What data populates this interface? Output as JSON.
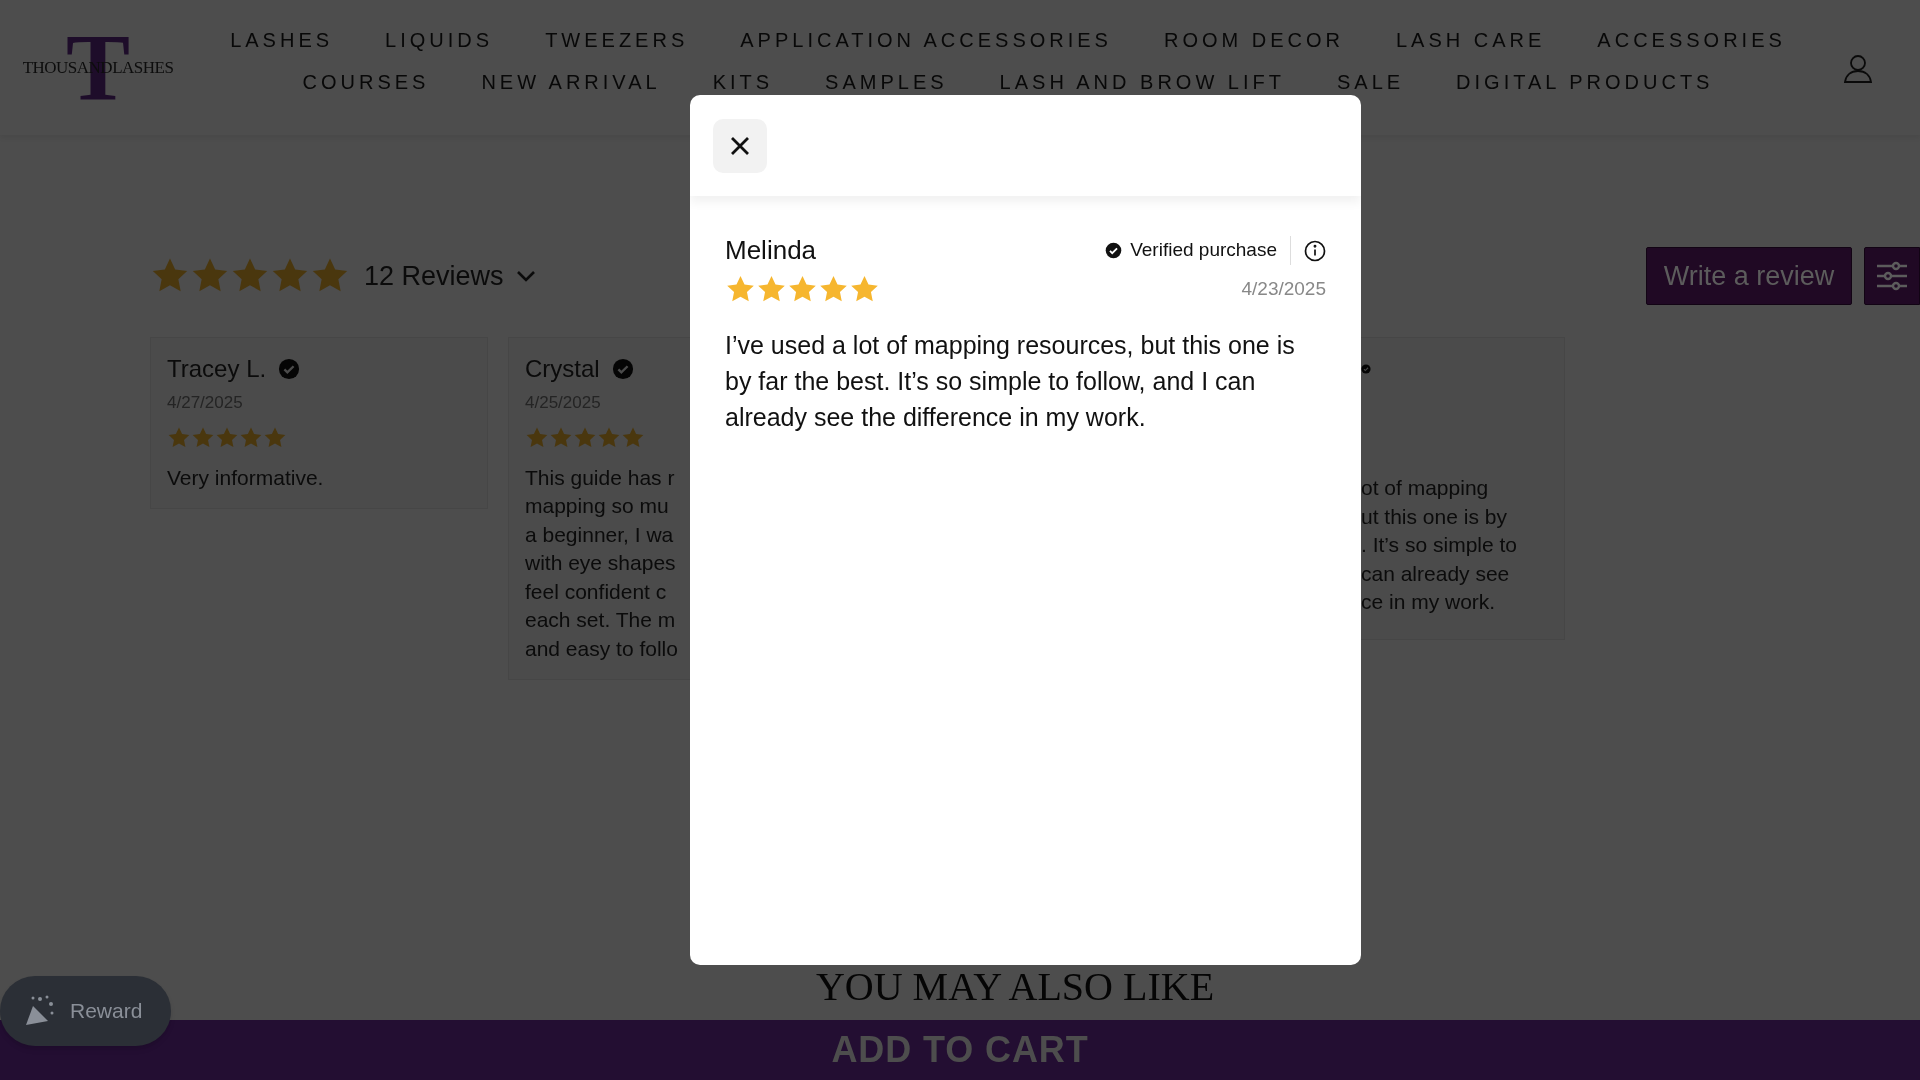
{
  "header": {
    "logo": {
      "mark": "T",
      "text": "THOUSANDLASHES"
    },
    "nav_rows": [
      [
        "LASHES",
        "LIQUIDS",
        "TWEEZERS",
        "APPLICATION ACCESSORIES",
        "ROOM DECOR",
        "LASH CARE",
        "ACCESSORIES"
      ],
      [
        "COURSES",
        "NEW ARRIVAL",
        "KITS",
        "SAMPLES",
        "LASH AND BROW LIFT",
        "SALE",
        "DIGITAL PRODUCTS"
      ]
    ]
  },
  "reviews": {
    "stars": 5,
    "count": "12 Reviews",
    "write_button": "Write a review",
    "cards": [
      {
        "name": "Tracey L.",
        "verified": true,
        "date": "4/27/2025",
        "stars": 5,
        "body": "Very informative."
      },
      {
        "name": "Crystal",
        "verified": true,
        "date": "4/25/2025",
        "stars": 5,
        "body": "This guide has r\nmapping so mu\na beginner, I wa\nwith eye shapes\nfeel confident c\neach set. The m\nand easy to follo"
      },
      {
        "verified": true,
        "body": "ot of mapping\nut this one is by\n. It’s so simple to\ncan already see\nce in my work."
      }
    ]
  },
  "modal": {
    "name": "Melinda",
    "verified_label": "Verified purchase",
    "date": "4/23/2025",
    "stars": 5,
    "body": "I’ve used a lot of mapping resources, but this one is by far the best. It’s so simple to follow, and I can already see the difference in my work."
  },
  "section_title": "YOU MAY ALSO LIKE",
  "reward": "Reward",
  "add_to_cart": "ADD TO CART"
}
